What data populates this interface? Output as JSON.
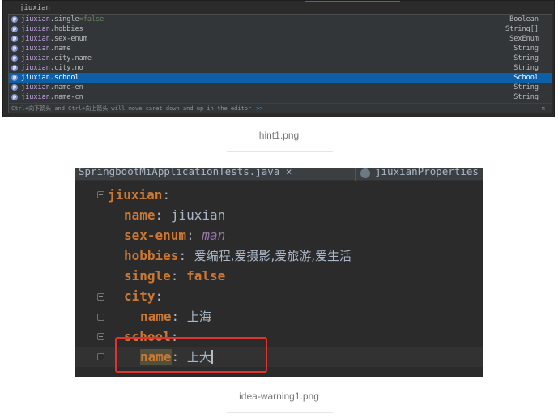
{
  "completion": {
    "query": "jiuxian",
    "items": [
      {
        "prefix": "jiuxian",
        "rest": ".single",
        "default": "=false",
        "type": "Boolean",
        "selected": false
      },
      {
        "prefix": "jiuxian",
        "rest": ".hobbies",
        "default": "",
        "type": "String[]",
        "selected": false
      },
      {
        "prefix": "jiuxian",
        "rest": ".sex-enum",
        "default": "",
        "type": "SexEnum",
        "selected": false
      },
      {
        "prefix": "jiuxian",
        "rest": ".name",
        "default": "",
        "type": "String",
        "selected": false
      },
      {
        "prefix": "jiuxian",
        "rest": ".city.name",
        "default": "",
        "type": "String",
        "selected": false
      },
      {
        "prefix": "jiuxian",
        "rest": ".city.no",
        "default": "",
        "type": "String",
        "selected": false
      },
      {
        "prefix": "jiuxian",
        "rest": ".school",
        "default": "",
        "type": "School",
        "selected": true
      },
      {
        "prefix": "jiuxian",
        "rest": ".name-en",
        "default": "",
        "type": "String",
        "selected": false
      },
      {
        "prefix": "jiuxian",
        "rest": ".name-cn",
        "default": "",
        "type": "String",
        "selected": false
      }
    ],
    "footer_hint": "Ctrl+向下箭头 and Ctrl+向上箭头 will move caret down and up in the editor",
    "footer_link": ">>",
    "footer_pi": "π",
    "icon_glyph": "p"
  },
  "captions": {
    "first": "hint1.png",
    "second": "idea-warning1.png"
  },
  "editor": {
    "tab_left": "SpringbootMiApplicationTests.java ×",
    "tab_right": "jiuxianProperties",
    "lines": {
      "l1_key": "jiuxian",
      "l2_key": "name",
      "l2_val": "jiuxian",
      "l3_key": "sex-enum",
      "l3_val": "man",
      "l4_key": "hobbies",
      "l4_val": "爱编程,爱摄影,爱旅游,爱生活",
      "l5_key": "single",
      "l5_val": "false",
      "l6_key": "city",
      "l7_key": "name",
      "l7_val": "上海",
      "l8_key": "school",
      "l9_key": "name",
      "l9_val": "上大"
    },
    "colon": ":",
    "colors": {
      "key": "#cc7832",
      "value": "#a9b7c6",
      "enum": "#9876aa",
      "highlight_box": "#e0322f",
      "selection": "#0d5fa8"
    }
  }
}
